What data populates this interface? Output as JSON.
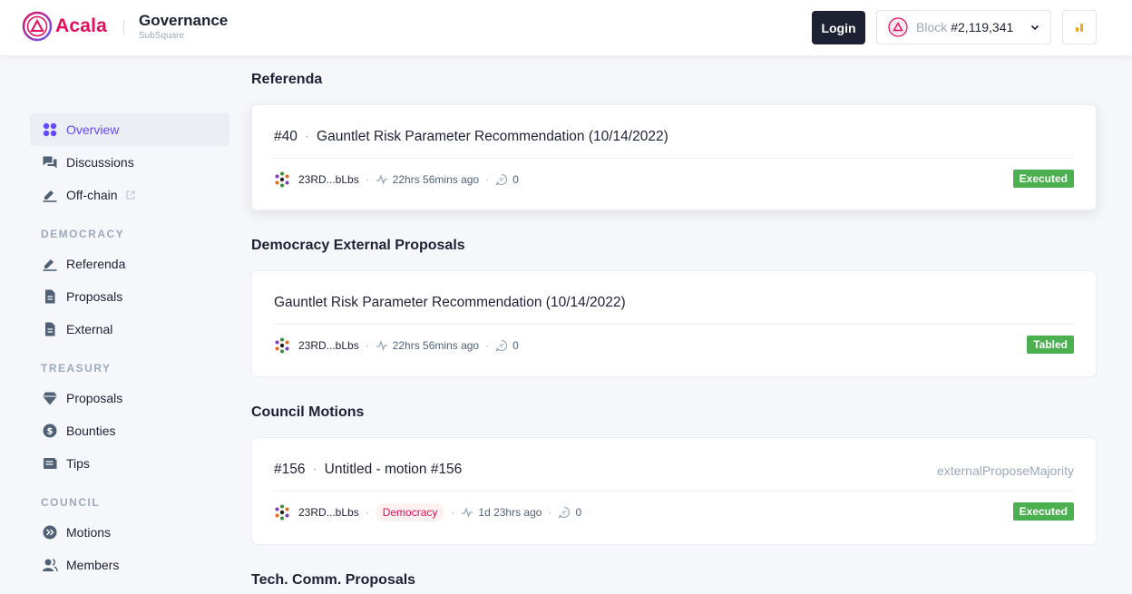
{
  "header": {
    "brand": "Acala",
    "app_title": "Governance",
    "app_subtitle": "SubSquare",
    "login_label": "Login",
    "block_label": "Block",
    "block_number": "#2,119,341"
  },
  "sidebar": {
    "top_items": [
      {
        "label": "Overview",
        "icon": "overview-icon",
        "active": true
      },
      {
        "label": "Discussions",
        "icon": "discussions-icon"
      },
      {
        "label": "Off-chain",
        "icon": "off-chain-icon",
        "external": true
      }
    ],
    "sections": [
      {
        "title": "DEMOCRACY",
        "items": [
          {
            "label": "Referenda",
            "icon": "referenda-icon"
          },
          {
            "label": "Proposals",
            "icon": "proposals-icon"
          },
          {
            "label": "External",
            "icon": "external-icon"
          }
        ]
      },
      {
        "title": "TREASURY",
        "items": [
          {
            "label": "Proposals",
            "icon": "treasury-proposals-icon"
          },
          {
            "label": "Bounties",
            "icon": "bounties-icon"
          },
          {
            "label": "Tips",
            "icon": "tips-icon"
          }
        ]
      },
      {
        "title": "COUNCIL",
        "items": [
          {
            "label": "Motions",
            "icon": "motions-icon"
          },
          {
            "label": "Members",
            "icon": "members-icon"
          }
        ]
      }
    ]
  },
  "main": {
    "referenda": {
      "heading": "Referenda",
      "index": "#40",
      "title": "Gauntlet Risk Parameter Recommendation (10/14/2022)",
      "author": "23RD...bLbs",
      "time": "22hrs 56mins ago",
      "comments": "0",
      "status": "Executed"
    },
    "external": {
      "heading": "Democracy External Proposals",
      "title": "Gauntlet Risk Parameter Recommendation (10/14/2022)",
      "author": "23RD...bLbs",
      "time": "22hrs 56mins ago",
      "comments": "0",
      "status": "Tabled"
    },
    "motions": {
      "heading": "Council Motions",
      "index": "#156",
      "title": "Untitled - motion #156",
      "method": "externalProposeMajority",
      "author": "23RD...bLbs",
      "tag": "Democracy",
      "time": "1d 23hrs ago",
      "comments": "0",
      "status": "Executed"
    },
    "tech_comm": {
      "heading": "Tech. Comm. Proposals"
    }
  },
  "colors": {
    "brand": "#e40c5b",
    "accent": "#6848ff",
    "status_green": "#4caf50",
    "dark": "#1e2134",
    "muted": "#9da9bb"
  }
}
